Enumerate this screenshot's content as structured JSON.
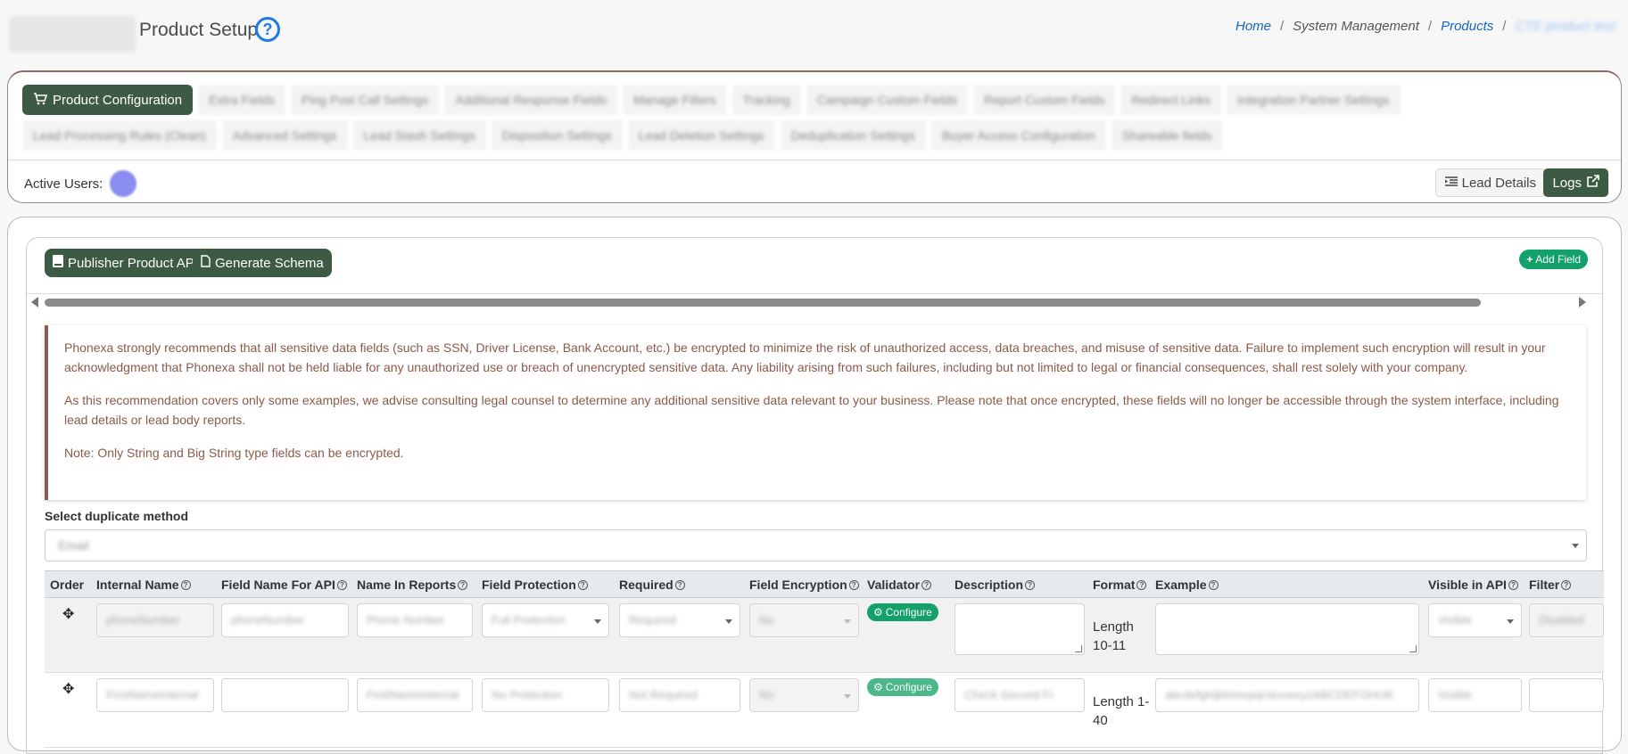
{
  "header": {
    "title": "Product Setup",
    "help_icon": "question-circle-icon",
    "breadcrumb": [
      "Home",
      "System Management",
      "Products",
      "CTE product test"
    ]
  },
  "tabs": {
    "row1": [
      "Product Configuration",
      "Extra Fields",
      "Ping Post Call Settings",
      "Additional Response Fields",
      "Manage Filters",
      "Tracking",
      "Campaign Custom Fields",
      "Report Custom Fields",
      "Redirect Links",
      "Integration Partner Settings"
    ],
    "row2": [
      "Lead Processing Rules (Clean)",
      "Advanced Settings",
      "Lead Stash Settings",
      "Disposition Settings",
      "Lead Deletion Settings",
      "Deduplication Settings",
      "Buyer Access Configuration",
      "Shareable fields"
    ]
  },
  "active_users": {
    "label": "Active Users:"
  },
  "actions": {
    "lead_details": "Lead Details",
    "logs": "Logs"
  },
  "toolbar": {
    "publisher_api": "Publisher Product API",
    "generate_schema": "Generate Schema",
    "add_field": "Add Field"
  },
  "warning": {
    "p1": "Phonexa strongly recommends that all sensitive data fields (such as SSN, Driver License, Bank Account, etc.) be encrypted to minimize the risk of unauthorized access, data breaches, and misuse of sensitive data. Failure to implement such encryption will result in your acknowledgment that Phonexa shall not be held liable for any unauthorized use or breach of unencrypted sensitive data. Any liability arising from such failures, including but not limited to legal or financial consequences, shall rest solely with your company.",
    "p2": "As this recommendation covers only some examples, we advise consulting legal counsel to determine any additional sensitive data relevant to your business. Please note that once encrypted, these fields will no longer be accessible through the system interface, including lead details or lead body reports.",
    "p3": "Note: Only String and Big String type fields can be encrypted."
  },
  "duplicate": {
    "label": "Select duplicate method",
    "value": "Email"
  },
  "table": {
    "headers": [
      "Order",
      "Internal Name",
      "Field Name For API",
      "Name In Reports",
      "Field Protection",
      "Required",
      "Field Encryption",
      "Validator",
      "Description",
      "Format",
      "Example",
      "Visible in API",
      "Filter"
    ],
    "rows": [
      {
        "internal_name": "phoneNumber",
        "api_name": "phoneNumber",
        "report_name": "Phone Number",
        "protection": "Full Protection",
        "required": "Required",
        "encryption": "No",
        "validator": "Configure",
        "format_line1": "Length",
        "format_line2": "10-11",
        "visible": "Visible",
        "filter": "Disabled"
      },
      {
        "internal_name": "FirstNameInternal",
        "api_name": "",
        "report_name": "FirstNameInternal",
        "protection": "No Protection",
        "required": "Not Required",
        "encryption": "No",
        "validator": "Configure",
        "description": "Check Second Fi",
        "format_line1": "Length 1-",
        "format_line2": "40",
        "example": "abcdefghijklmnopqrstuvwxyzABCDEFGHIJK",
        "visible": "Visible",
        "filter": ""
      }
    ]
  }
}
